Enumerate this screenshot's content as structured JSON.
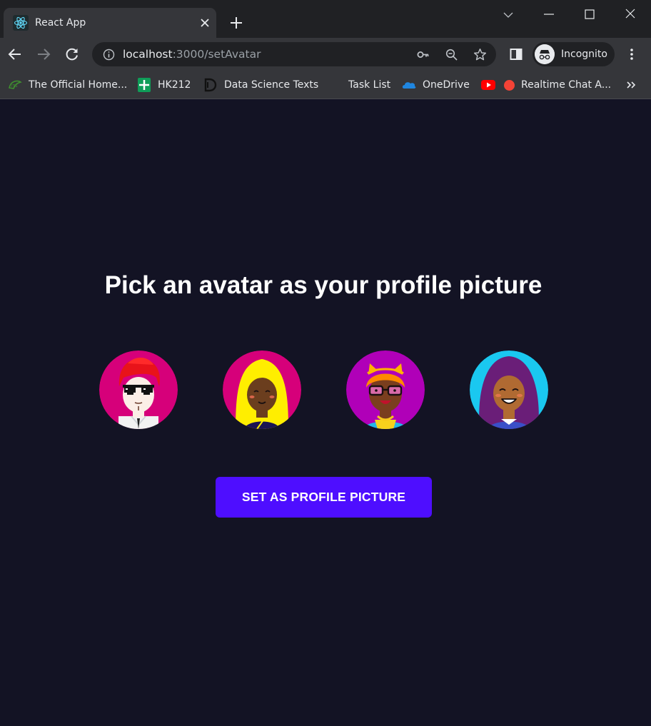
{
  "browser": {
    "tab": {
      "title": "React App",
      "favicon": "react-logo-icon"
    },
    "address_bar": {
      "host": "localhost",
      "rest": ":3000/setAvatar"
    },
    "profile": {
      "label": "Incognito",
      "icon": "incognito-icon"
    },
    "bookmarks": [
      {
        "label": "The Official Home...",
        "icon": "leaf-logo-icon"
      },
      {
        "label": "HK212",
        "icon": "sheets-icon"
      },
      {
        "label": "Data Science Texts",
        "icon": "ds-logo-icon"
      },
      {
        "label": "Task List",
        "icon": ""
      },
      {
        "label": "OneDrive",
        "icon": "onedrive-icon"
      },
      {
        "label": "",
        "icon": "youtube-icon"
      },
      {
        "label": "Realtime Chat A...",
        "icon": "red-dot-icon"
      }
    ],
    "colors": {
      "tabbar": "#202124",
      "toolbar": "#35363a"
    }
  },
  "page": {
    "title": "Pick an avatar as your profile picture",
    "avatars": [
      {
        "name": "avatar-1",
        "bg": "#d6007a"
      },
      {
        "name": "avatar-2",
        "bg": "#d6007a"
      },
      {
        "name": "avatar-3",
        "bg": "#b000b8"
      },
      {
        "name": "avatar-4",
        "bg": "#1ac8f0"
      }
    ],
    "button_label": "SET AS PROFILE PICTURE",
    "colors": {
      "background": "#131324",
      "accent": "#4e0eff",
      "text": "#ffffff"
    }
  }
}
